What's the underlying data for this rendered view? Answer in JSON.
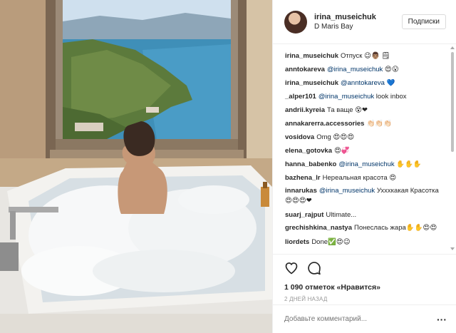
{
  "header": {
    "username": "irina_museichuk",
    "location": "D Maris Bay",
    "follow_label": "Подписки"
  },
  "comments": [
    {
      "user": "irina_museichuk",
      "text": "Отпуск 😉👨🏽 🗒"
    },
    {
      "user": "anntokareva",
      "mention": "@irina_museichuk",
      "text": " 😍😮"
    },
    {
      "user": "irina_museichuk",
      "mention": "@anntokareva",
      "text": " 💙"
    },
    {
      "user": "_alper101",
      "mention": "@irina_museichuk",
      "text": " look inbox"
    },
    {
      "user": "andrii.kyreia",
      "text": "Та ваще 😵❤"
    },
    {
      "user": "annakarerra.accessories",
      "text": "👏🏻👏🏻👏🏻"
    },
    {
      "user": "vosidova",
      "text": "Omg 😍😍😍"
    },
    {
      "user": "elena_gotovka",
      "text": "😍💞"
    },
    {
      "user": "hanna_babenko",
      "mention": "@irina_museichuk",
      "text": " ✋✋✋"
    },
    {
      "user": "bazhena_lr",
      "text": "Нереальная красота 😍"
    },
    {
      "user": "innarukas",
      "mention": "@irina_museichuk",
      "text": " Ухххкакая Красотка 😍😍😍❤"
    },
    {
      "user": "suarj_rajput",
      "text": "Ultimate..."
    },
    {
      "user": "grechishkina_nastya",
      "text": "Понеслась жара✋✋😍😍"
    },
    {
      "user": "liordets",
      "text": "Done✅😍😉"
    }
  ],
  "actions": {
    "likes": "1 090 отметок «Нравится»",
    "time_ago": "2 ДНЕЙ НАЗАД"
  },
  "comment_input": {
    "placeholder": "Добавьте комментарий..."
  },
  "icons": {
    "like": "heart-icon",
    "comment": "comment-icon",
    "more": "more-options-icon"
  },
  "colors": {
    "link": "#003569",
    "muted": "#999999",
    "border": "#efefef"
  }
}
